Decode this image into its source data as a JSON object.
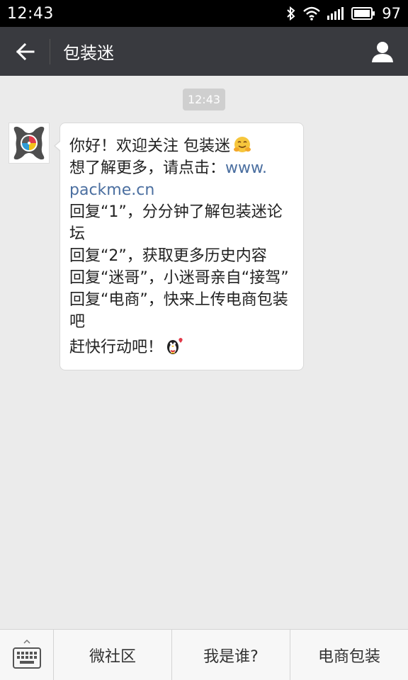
{
  "status_bar": {
    "time": "12:43",
    "battery": "97",
    "icons": [
      "bluetooth-icon",
      "wifi-icon",
      "signal-icon",
      "battery-icon"
    ]
  },
  "header": {
    "title": "包装迷",
    "back_icon": "back-arrow-icon",
    "profile_icon": "person-icon",
    "background": "#393a3f"
  },
  "chat": {
    "timestamp": "12:43",
    "message": {
      "line1": "你好！欢迎关注 包装迷",
      "line2_text": "想了解更多，请点击：",
      "link_part1": "www.",
      "link_part2": "packme.cn",
      "line3": "回复“1”，分分钟了解包装迷论坛",
      "line4": "回复“2”，获取更多历史内容",
      "line5": "回复“迷哥”，小迷哥亲自“接驾”",
      "line6": "回复“电商”，快来上传电商包装吧",
      "line7": "赶快行动吧！",
      "emoji1": "hug-emoji-icon",
      "emoji2": "penguin-heart-icon"
    }
  },
  "bottom_bar": {
    "keyboard_icon": "keyboard-icon",
    "menu": [
      "微社区",
      "我是谁?",
      "电商包装"
    ]
  },
  "colors": {
    "chat_background": "#ebebeb",
    "link": "#4b6fa0"
  }
}
